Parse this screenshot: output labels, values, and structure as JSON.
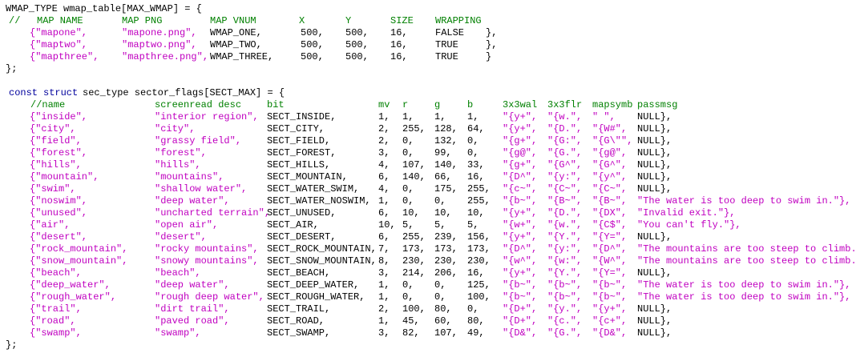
{
  "theme": {
    "background": "#ffffff",
    "plain": "#000000",
    "keyword": "#00009c",
    "comment": "#008000",
    "string": "#c000c0"
  },
  "code": {
    "wmap_decl": "WMAP_TYPE wmap_table[MAX_WMAP] = {",
    "wmap_header": [
      "//",
      "MAP NAME",
      "MAP PNG",
      "MAP VNUM",
      "X",
      "Y",
      "SIZE",
      "WRAPPING"
    ],
    "wmap_rows": [
      [
        "{\"mapone\",",
        "\"mapone.png\",",
        "WMAP_ONE,",
        "500,",
        "500,",
        "16,",
        "FALSE",
        "},"
      ],
      [
        "{\"maptwo\",",
        "\"maptwo.png\",",
        "WMAP_TWO,",
        "500,",
        "500,",
        "16,",
        "TRUE",
        "},"
      ],
      [
        "{\"mapthree\",",
        "\"mapthree.png\",",
        "WMAP_THREE,",
        "500,",
        "500,",
        "16,",
        "TRUE",
        "}"
      ]
    ],
    "wmap_close": "};",
    "sector_decl": {
      "const": "const",
      "struct": "struct",
      "rest": "sec_type sector_flags[SECT_MAX] = {"
    },
    "sector_header": [
      "//name",
      "screenread desc",
      "bit",
      "mv",
      "r",
      "g",
      "b",
      "3x3wal",
      "3x3flr",
      "mapsymb",
      "passmsg"
    ],
    "sector_rows": [
      [
        "{\"inside\",",
        "\"interior region\",",
        "SECT_INSIDE,",
        "1,",
        "1,",
        "1,",
        "1,",
        "\"{y+\",",
        "\"{w.\",",
        "\" \",",
        "NULL},"
      ],
      [
        "{\"city\",",
        "\"city\",",
        "SECT_CITY,",
        "2,",
        "255,",
        "128,",
        "64,",
        "\"{y+\",",
        "\"{D.\",",
        "\"{W#\",",
        "NULL},"
      ],
      [
        "{\"field\",",
        "\"grassy field\",",
        "SECT_FIELD,",
        "2,",
        "0,",
        "132,",
        "0,",
        "\"{g+\",",
        "\"{G:\",",
        "\"{G\\\"\",",
        "NULL},"
      ],
      [
        "{\"forest\",",
        "\"forest\",",
        "SECT_FOREST,",
        "3,",
        "0,",
        "99,",
        "0,",
        "\"{g@\",",
        "\"{G.\",",
        "\"{g@\",",
        "NULL},"
      ],
      [
        "{\"hills\",",
        "\"hills\",",
        "SECT_HILLS,",
        "4,",
        "107,",
        "140,",
        "33,",
        "\"{g+\",",
        "\"{G^\",",
        "\"{G^\",",
        "NULL},"
      ],
      [
        "{\"mountain\",",
        "\"mountains\",",
        "SECT_MOUNTAIN,",
        "6,",
        "140,",
        "66,",
        "16,",
        "\"{D^\",",
        "\"{y:\",",
        "\"{y^\",",
        "NULL},"
      ],
      [
        "{\"swim\",",
        "\"shallow water\",",
        "SECT_WATER_SWIM,",
        "4,",
        "0,",
        "175,",
        "255,",
        "\"{c~\",",
        "\"{C~\",",
        "\"{C~\",",
        "NULL},"
      ],
      [
        "{\"noswim\",",
        "\"deep water\",",
        "SECT_WATER_NOSWIM,",
        "1,",
        "0,",
        "0,",
        "255,",
        "\"{b~\",",
        "\"{B~\",",
        "\"{B~\",",
        "\"The water is too deep to swim in.\"},"
      ],
      [
        "{\"unused\",",
        "\"uncharted terrain\",",
        "SECT_UNUSED,",
        "6,",
        "10,",
        "10,",
        "10,",
        "\"{y+\",",
        "\"{D.\",",
        "\"{DX\",",
        "\"Invalid exit.\"},"
      ],
      [
        "{\"air\",",
        "\"open air\",",
        "SECT_AIR,",
        "10,",
        "5,",
        "5,",
        "5,",
        "\"{w+\",",
        "\"{w.\",",
        "\"{C$\",",
        "\"You can't fly.\"},"
      ],
      [
        "{\"desert\",",
        "\"desert\",",
        "SECT_DESERT,",
        "6,",
        "255,",
        "239,",
        "156,",
        "\"{y+\",",
        "\"{Y.\",",
        "\"{Y=\",",
        "NULL},"
      ],
      [
        "{\"rock_mountain\",",
        "\"rocky mountains\",",
        "SECT_ROCK_MOUNTAIN,",
        "7,",
        "173,",
        "173,",
        "173,",
        "\"{D^\",",
        "\"{y:\",",
        "\"{D^\",",
        "\"The mountains are too steep to climb.\""
      ],
      [
        "{\"snow_mountain\",",
        "\"snowy mountains\",",
        "SECT_SNOW_MOUNTAIN,",
        "8,",
        "230,",
        "230,",
        "230,",
        "\"{w^\",",
        "\"{w:\",",
        "\"{W^\",",
        "\"The mountains are too steep to climb.\""
      ],
      [
        "{\"beach\",",
        "\"beach\",",
        "SECT_BEACH,",
        "3,",
        "214,",
        "206,",
        "16,",
        "\"{y+\",",
        "\"{Y.\",",
        "\"{Y=\",",
        "NULL},"
      ],
      [
        "{\"deep_water\",",
        "\"deep water\",",
        "SECT_DEEP_WATER,",
        "1,",
        "0,",
        "0,",
        "125,",
        "\"{b~\",",
        "\"{b~\",",
        "\"{b~\",",
        "\"The water is too deep to swim in.\"},"
      ],
      [
        "{\"rough_water\",",
        "\"rough deep water\",",
        "SECT_ROUGH_WATER,",
        "1,",
        "0,",
        "0,",
        "100,",
        "\"{b~\",",
        "\"{b~\",",
        "\"{b~\",",
        "\"The water is too deep to swim in.\"},"
      ],
      [
        "{\"trail\",",
        "\"dirt trail\",",
        "SECT_TRAIL,",
        "2,",
        "100,",
        "80,",
        "0,",
        "\"{D+\",",
        "\"{y.\",",
        "\"{y+\",",
        "NULL},"
      ],
      [
        "{\"road\",",
        "\"paved road\",",
        "SECT_ROAD,",
        "1,",
        "45,",
        "60,",
        "80,",
        "\"{D+\",",
        "\"{c.\",",
        "\"{c+\",",
        "NULL},"
      ],
      [
        "{\"swamp\",",
        "\"swamp\",",
        "SECT_SWAMP,",
        "3,",
        "82,",
        "107,",
        "49,",
        "\"{D&\",",
        "\"{G.\",",
        "\"{D&\",",
        "NULL},"
      ]
    ],
    "sector_close": "};"
  }
}
